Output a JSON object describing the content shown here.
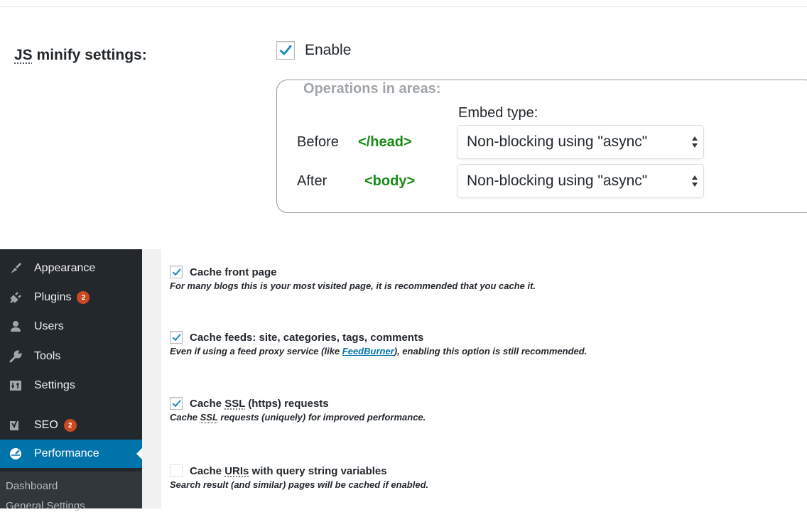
{
  "js_minify": {
    "label_acronym": "JS",
    "label_rest": " minify settings:",
    "enable_label": "Enable",
    "enable_checked": true,
    "legend": "Operations in areas:",
    "embed_type_label": "Embed type:",
    "rows": [
      {
        "where": "Before",
        "tag": "</head>",
        "select_value": "Non-blocking using \"async\""
      },
      {
        "where": "After",
        "tag": "<body>",
        "select_value": "Non-blocking using \"async\""
      }
    ]
  },
  "sidebar": {
    "items": [
      {
        "label": "Appearance",
        "icon": "paintbrush-icon"
      },
      {
        "label": "Plugins",
        "icon": "plugin-icon",
        "badge": "2"
      },
      {
        "label": "Users",
        "icon": "users-icon"
      },
      {
        "label": "Tools",
        "icon": "wrench-icon"
      },
      {
        "label": "Settings",
        "icon": "settings-icon"
      },
      {
        "label": "SEO",
        "icon": "yoast-icon",
        "badge": "2"
      },
      {
        "label": "Performance",
        "icon": "performance-icon",
        "active": true
      }
    ],
    "submenu": [
      "Dashboard",
      "General Settings"
    ]
  },
  "cache_options": [
    {
      "title": "Cache front page",
      "checked": true,
      "desc": "For many blogs this is your most visited page, it is recommended that you cache it."
    },
    {
      "title": "Cache feeds: site, categories, tags, comments",
      "checked": true,
      "desc_before": "Even if using a feed proxy service (like ",
      "desc_link": "FeedBurner",
      "desc_after": "), enabling this option is still recommended."
    },
    {
      "title_before": "Cache ",
      "title_acronym": "SSL",
      "title_after": " (https) requests",
      "checked": true,
      "desc_before": "Cache ",
      "desc_acronym": "SSL",
      "desc_after": " requests (uniquely) for improved performance."
    },
    {
      "title_before": "Cache ",
      "title_acronym": "URIs",
      "title_after": " with query string variables",
      "checked": false,
      "desc": "Search result (and similar) pages will be cached if enabled."
    }
  ],
  "colors": {
    "accent": "#0073aa",
    "tag_green": "#1a8a16",
    "sidebar_bg": "#23282d",
    "badge": "#ca4a1f"
  }
}
